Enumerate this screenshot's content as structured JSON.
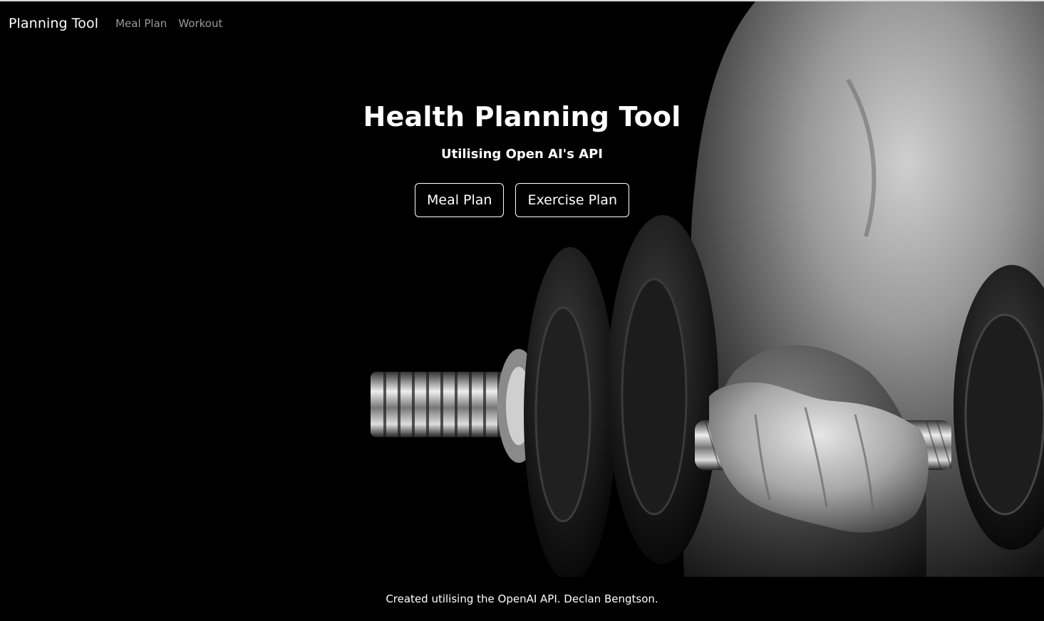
{
  "nav": {
    "brand": "Planning Tool",
    "links": [
      "Meal Plan",
      "Workout"
    ]
  },
  "hero": {
    "title": "Health Planning Tool",
    "subtitle": "Utilising Open AI's API",
    "buttons": [
      "Meal Plan",
      "Exercise Plan"
    ],
    "image_alt": "black and white photo of an arm curling a dumbbell"
  },
  "footer": {
    "text": "Created utilising the OpenAI API. Declan Bengtson."
  },
  "colors": {
    "background": "#000000",
    "text": "#ffffff",
    "nav_link": "#9a9a9a"
  }
}
